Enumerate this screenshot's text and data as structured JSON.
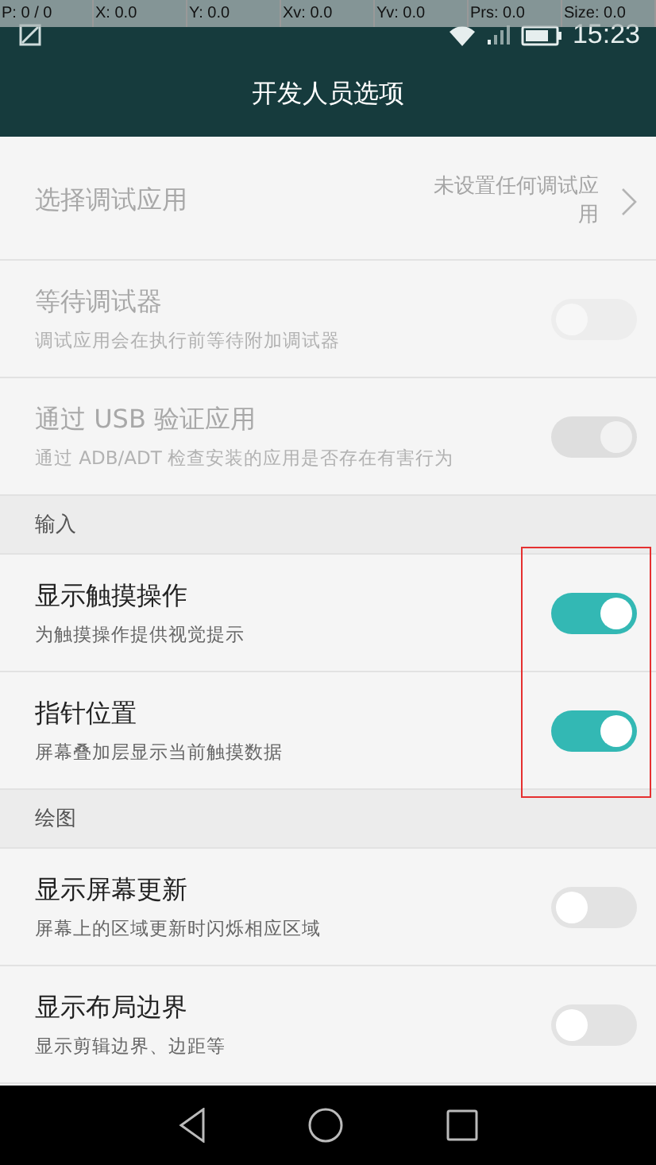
{
  "pointer_overlay": [
    "P: 0 / 0",
    "X: 0.0",
    "Y: 0.0",
    "Xv: 0.0",
    "Yv: 0.0",
    "Prs: 0.0",
    "Size: 0.0"
  ],
  "status_bar": {
    "time": "15:23"
  },
  "header": {
    "title": "开发人员选项"
  },
  "items": [
    {
      "kind": "link",
      "title": "选择调试应用",
      "value": "未设置任何调试应用",
      "disabled": true
    },
    {
      "kind": "toggle",
      "title": "等待调试器",
      "subtitle": "调试应用会在执行前等待附加调试器",
      "on": false,
      "disabled": true
    },
    {
      "kind": "toggle",
      "title": "通过 USB 验证应用",
      "subtitle": "通过 ADB/ADT 检查安装的应用是否存在有害行为",
      "on": true,
      "disabled": true
    },
    {
      "kind": "section",
      "title": "输入"
    },
    {
      "kind": "toggle",
      "title": "显示触摸操作",
      "subtitle": "为触摸操作提供视觉提示",
      "on": true,
      "disabled": false
    },
    {
      "kind": "toggle",
      "title": "指针位置",
      "subtitle": "屏幕叠加层显示当前触摸数据",
      "on": true,
      "disabled": false
    },
    {
      "kind": "section",
      "title": "绘图"
    },
    {
      "kind": "toggle",
      "title": "显示屏幕更新",
      "subtitle": "屏幕上的区域更新时闪烁相应区域",
      "on": false,
      "disabled": false
    },
    {
      "kind": "toggle",
      "title": "显示布局边界",
      "subtitle": "显示剪辑边界、边距等",
      "on": false,
      "disabled": false
    }
  ]
}
